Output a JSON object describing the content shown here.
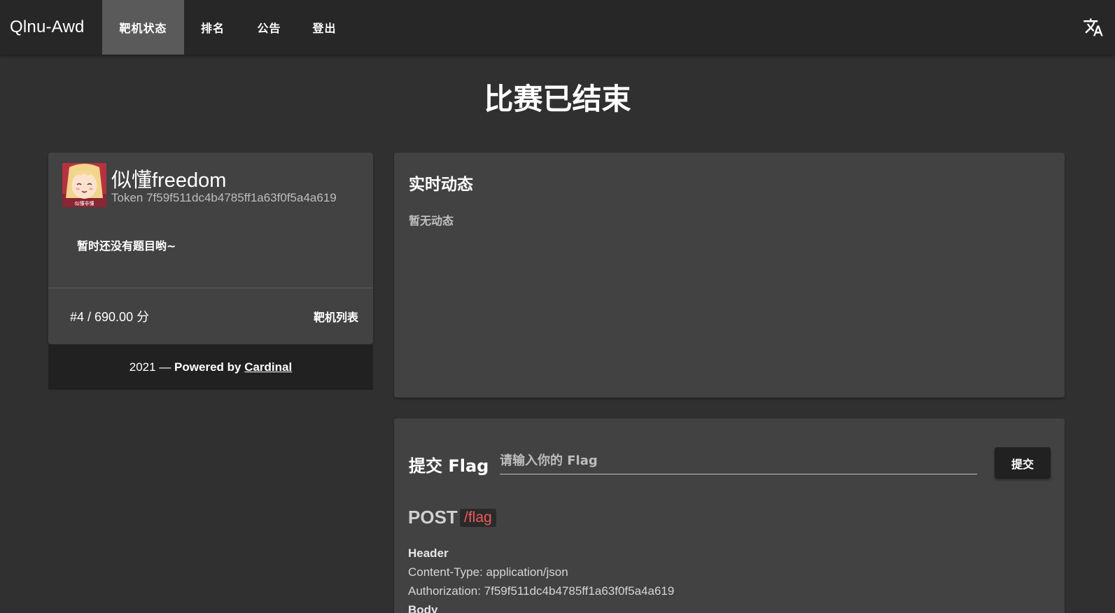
{
  "app": {
    "title": "Qlnu-Awd"
  },
  "nav": {
    "tabs": [
      {
        "label": "靶机状态",
        "active": true
      },
      {
        "label": "排名",
        "active": false
      },
      {
        "label": "公告",
        "active": false
      },
      {
        "label": "登出",
        "active": false
      }
    ],
    "translate_icon": "translate-icon"
  },
  "page": {
    "title": "比赛已结束"
  },
  "profile": {
    "username": "似懂freedom",
    "token_text": "Token 7f59f511dc4b4785ff1a63f0f5a4a619",
    "avatar_caption": "似懂非懂",
    "empty_challenges": "暂时还没有题目哟~",
    "rank_score": "#4 / 690.00 分",
    "target_list_label": "靶机列表"
  },
  "footer": {
    "year": "2021",
    "powered": "Powered by",
    "link": "Cardinal"
  },
  "feed": {
    "title": "实时动态",
    "empty": "暂无动态"
  },
  "flag": {
    "label": "提交 Flag",
    "placeholder": "请输入你的 Flag",
    "value": "",
    "submit_label": "提交"
  },
  "api": {
    "method": "POST",
    "path": "/flag",
    "header_title": "Header",
    "content_type": "Content-Type: application/json",
    "authorization": "Authorization: 7f59f511dc4b4785ff1a63f0f5a4a619",
    "body_title": "Body"
  },
  "colors": {
    "appbar": "#272727",
    "background": "#303030",
    "card": "#424242",
    "footer": "#212121",
    "active_tab": "#5a5a5a",
    "path_red": "#f05a5a"
  }
}
